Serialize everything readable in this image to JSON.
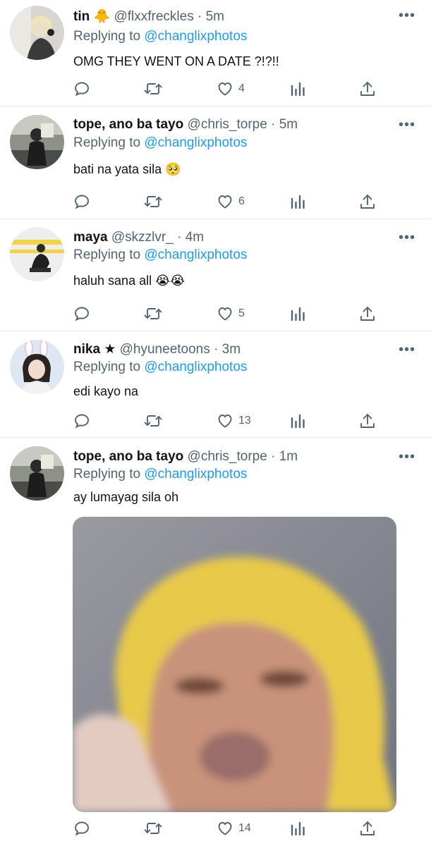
{
  "replies": [
    {
      "name": "tin",
      "emoji": "🐥",
      "handle": "@flxxfreckles",
      "separator": "·",
      "time": "5m",
      "replying_prefix": "Replying to",
      "replying_to": "@changlixphotos",
      "text": "OMG THEY WENT ON A DATE ?!?!!",
      "likes": "4"
    },
    {
      "name": "tope, ano ba tayo",
      "handle": "@chris_torpe",
      "separator": "·",
      "time": "5m",
      "replying_prefix": "Replying to",
      "replying_to": "@changlixphotos",
      "text": "bati na yata sila 🥺",
      "likes": "6"
    },
    {
      "name": "maya",
      "handle": "@skzzlvr_",
      "separator": "·",
      "time": "4m",
      "replying_prefix": "Replying to",
      "replying_to": "@changlixphotos",
      "text": "haluh sana all 😭😭",
      "likes": "5"
    },
    {
      "name": "nika",
      "badge": "★",
      "handle": "@hyuneetoons",
      "separator": "·",
      "time": "3m",
      "replying_prefix": "Replying to",
      "replying_to": "@changlixphotos",
      "text": "edi kayo na",
      "likes": "13"
    },
    {
      "name": "tope, ano ba tayo",
      "handle": "@chris_torpe",
      "separator": "·",
      "time": "1m",
      "replying_prefix": "Replying to",
      "replying_to": "@changlixphotos",
      "text": "ay lumayag sila oh",
      "likes": "14",
      "has_media": true
    }
  ],
  "more_label": "•••",
  "icons": [
    "reply-icon",
    "retweet-icon",
    "like-icon",
    "analytics-icon",
    "share-icon"
  ],
  "colors": {
    "mention": "#1d9bf0",
    "secondary_text": "#536471",
    "primary_text": "#0f1419",
    "divider": "#e6e9ec"
  }
}
